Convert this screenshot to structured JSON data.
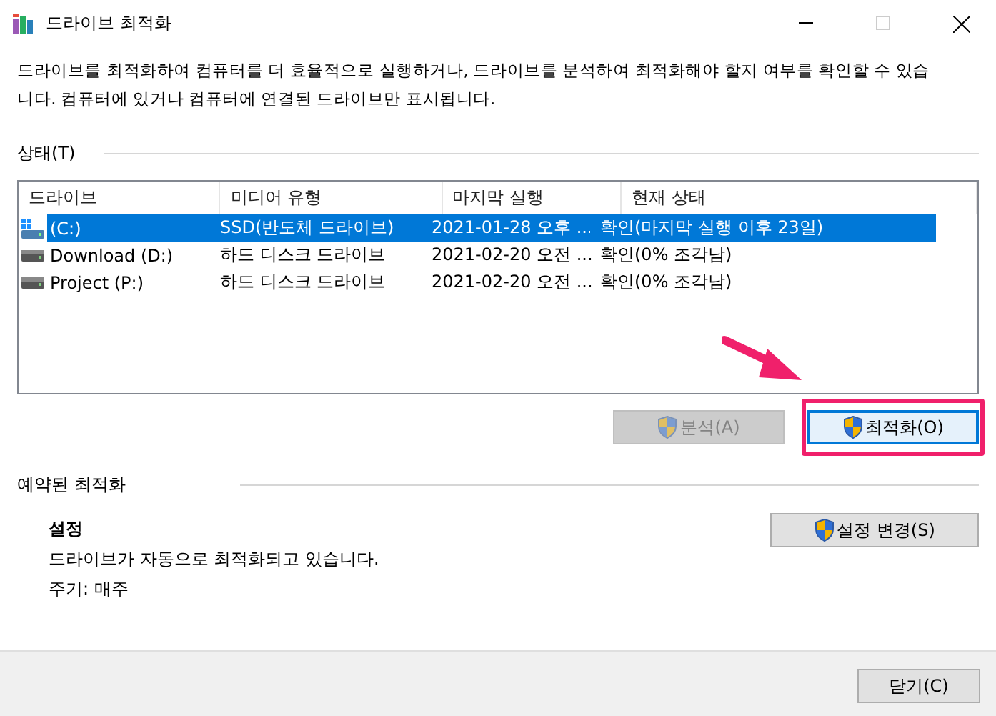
{
  "window": {
    "title": "드라이브 최적화"
  },
  "description": "드라이브를 최적화하여 컴퓨터를 더 효율적으로 실행하거나, 드라이브를 분석하여 최적화해야 할지 여부를 확인할 수 있습니다. 컴퓨터에 있거나 컴퓨터에 연결된 드라이브만 표시됩니다.",
  "status_section": {
    "label": "상태(T)",
    "table": {
      "columns": [
        "드라이브",
        "미디어 유형",
        "마지막 실행",
        "현재 상태"
      ],
      "rows": [
        {
          "kind": "ssd",
          "selected": true,
          "cells": [
            "(C:)",
            "SSD(반도체 드라이브)",
            "2021-01-28 오후 ...",
            "확인(마지막 실행 이후 23일)"
          ]
        },
        {
          "kind": "hdd",
          "selected": false,
          "cells": [
            "Download (D:)",
            "하드 디스크 드라이브",
            "2021-02-20 오전 ...",
            "확인(0% 조각남)"
          ]
        },
        {
          "kind": "hdd",
          "selected": false,
          "cells": [
            "Project (P:)",
            "하드 디스크 드라이브",
            "2021-02-20 오전 ...",
            "확인(0% 조각남)"
          ]
        }
      ]
    },
    "buttons": [
      {
        "label": "분석(A)",
        "disabled": true,
        "highlighted": false
      },
      {
        "label": "최적화(O)",
        "disabled": false,
        "highlighted": true
      }
    ]
  },
  "scheduled_section": {
    "label": "예약된 최적화",
    "heading": "설정",
    "lines": [
      "드라이브가 자동으로 최적화되고 있습니다.",
      "주기: 매주"
    ],
    "button": {
      "label": "설정 변경(S)"
    }
  },
  "footer": {
    "close_button": {
      "label": "닫기(C)"
    }
  }
}
